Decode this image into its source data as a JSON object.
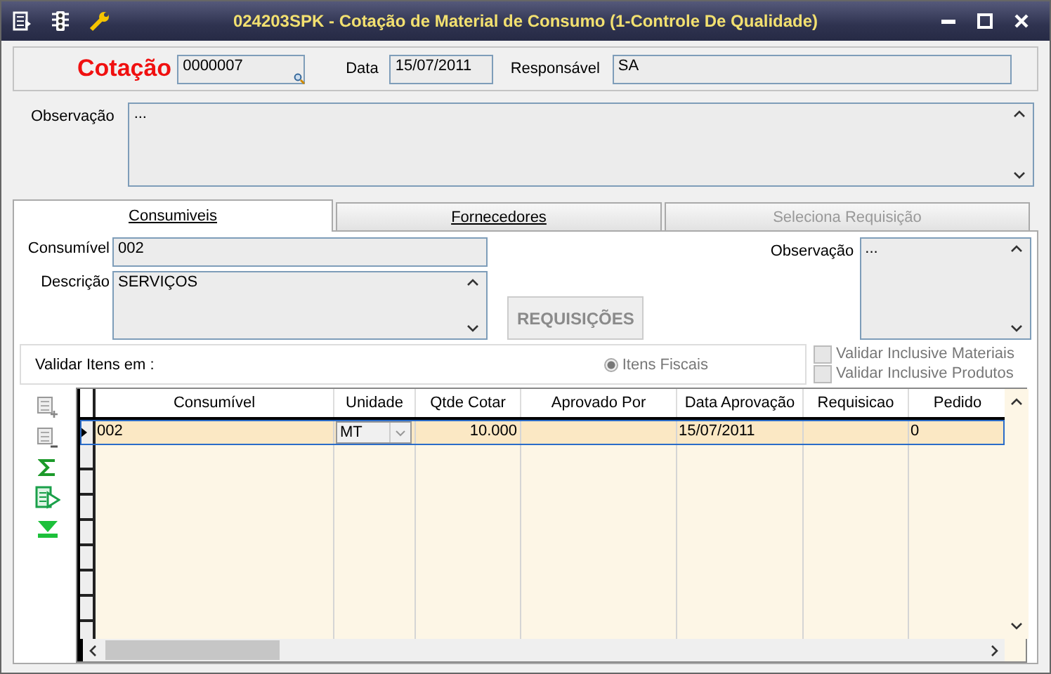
{
  "window": {
    "title": "024203SPK - Cotação de Material de Consumo (1-Controle De Qualidade)"
  },
  "header": {
    "cotacao_label": "Cotação",
    "cotacao_value": "0000007",
    "data_label": "Data",
    "data_value": "15/07/2011",
    "responsavel_label": "Responsável",
    "responsavel_value": "SA"
  },
  "observacao": {
    "label": "Observação",
    "value": "..."
  },
  "tabs": [
    {
      "label": "Consumiveis",
      "selected": true,
      "disabled": false
    },
    {
      "label": "Fornecedores",
      "selected": false,
      "disabled": false
    },
    {
      "label": "Seleciona Requisição",
      "selected": false,
      "disabled": true
    }
  ],
  "consumivel_form": {
    "consumivel_label": "Consumível",
    "consumivel_value": "002",
    "descricao_label": "Descrição",
    "descricao_value": "SERVIÇOS",
    "observacao_label": "Observação",
    "observacao_value": "...",
    "button": {
      "label": "REQUISIÇÕES",
      "disabled": true
    }
  },
  "validar": {
    "label": "Validar Itens em :",
    "radio": {
      "label": "Itens Fiscais",
      "selected": true,
      "disabled": true
    },
    "checkboxes": [
      {
        "label": "Validar Inclusive Materiais",
        "checked": false,
        "disabled": true
      },
      {
        "label": "Validar Inclusive Produtos",
        "checked": false,
        "disabled": true
      }
    ]
  },
  "grid": {
    "columns": [
      "Consumível",
      "Unidade",
      "Qtde Cotar",
      "Aprovado Por",
      "Data Aprovação",
      "Requisicao",
      "Pedido"
    ],
    "rows": [
      {
        "selected": true,
        "cells": [
          "002",
          "MT",
          "10.000",
          "",
          "15/07/2011",
          "",
          "0"
        ]
      }
    ]
  }
}
